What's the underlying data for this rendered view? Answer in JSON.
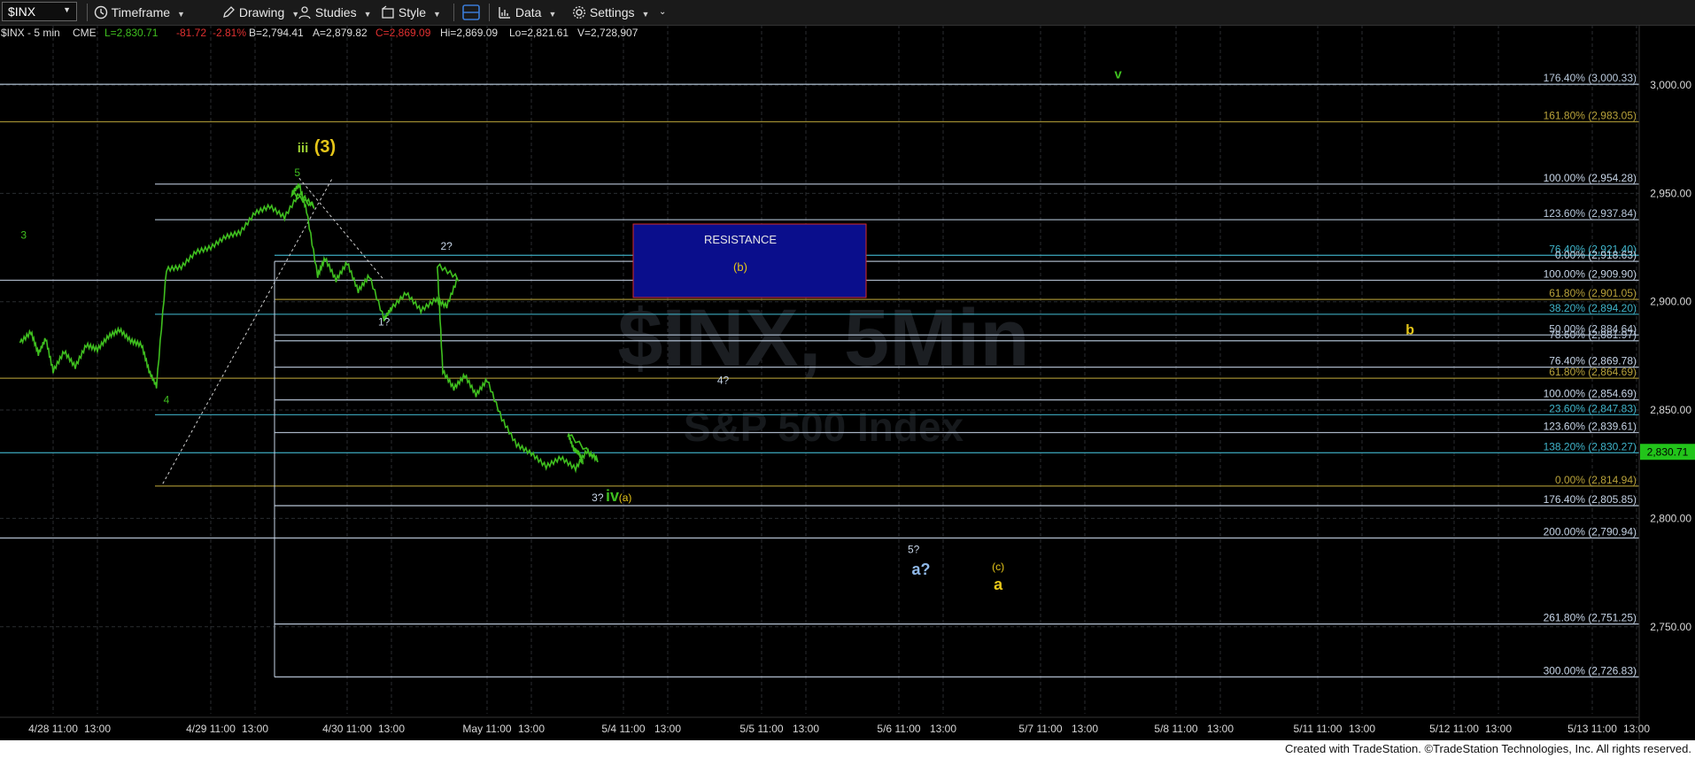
{
  "toolbar": {
    "symbol": "$INX",
    "timeframe": "Timeframe",
    "drawing": "Drawing",
    "studies": "Studies",
    "style": "Style",
    "data": "Data",
    "settings": "Settings"
  },
  "header": {
    "symbol": "$INX - 5 min",
    "exchange": "CME",
    "last": "L=2,830.71",
    "change": "-81.72",
    "pct": "-2.81%",
    "bid": "B=2,794.41",
    "ask": "A=2,879.82",
    "close": "C=2,869.09",
    "hi": "Hi=2,869.09",
    "lo": "Lo=2,821.61",
    "vol": "V=2,728,907"
  },
  "watermark": {
    "title": "$INX, 5Min",
    "subtitle": "S&P 500 Index"
  },
  "price_axis": {
    "ticks": [
      "3,000.00",
      "2,950.00",
      "2,900.00",
      "2,850.00",
      "2,800.00",
      "2,750.00"
    ],
    "tick_values": [
      3000,
      2950,
      2900,
      2850,
      2800,
      2750
    ],
    "last_price": "2,830.71",
    "last_value": 2830.71
  },
  "time_axis": {
    "labels": [
      "4/28 11:00",
      "13:00",
      "4/29 11:00",
      "13:00",
      "4/30 11:00",
      "13:00",
      "May 11:00",
      "13:00",
      "5/4 11:00",
      "13:00",
      "5/5 11:00",
      "13:00",
      "5/6 11:00",
      "13:00",
      "5/7 11:00",
      "13:00",
      "5/8 11:00",
      "13:00",
      "5/11 11:00",
      "13:00",
      "5/12 11:00",
      "13:00",
      "5/13 11:00",
      "13:00"
    ]
  },
  "fib_levels": [
    {
      "label": "176.40% (3,000.33)",
      "price": 3000.33,
      "color": "#b9c9dc"
    },
    {
      "label": "161.80% (2,983.05)",
      "price": 2983.05,
      "color": "#b8a23a"
    },
    {
      "label": "100.00% (2,954.28)",
      "price": 2954.28,
      "color": "#c6d4e6"
    },
    {
      "label": "123.60% (2,937.84)",
      "price": 2937.84,
      "color": "#b9c9dc"
    },
    {
      "label": "76.40% (2,921.40)",
      "price": 2921.4,
      "color": "#3fb3c9"
    },
    {
      "label": "0.00% (2,918.63)",
      "price": 2918.63,
      "color": "#c6d4e6"
    },
    {
      "label": "100.00% (2,909.90)",
      "price": 2909.9,
      "color": "#c6d4e6"
    },
    {
      "label": "61.80% (2,901.05)",
      "price": 2901.05,
      "color": "#b8a23a"
    },
    {
      "label": "38.20% (2,894.20)",
      "price": 2894.2,
      "color": "#3fb3c9"
    },
    {
      "label": "50.00% (2,884.64)",
      "price": 2884.64,
      "color": "#b9c9dc"
    },
    {
      "label": "78.60% (2,881.97)",
      "price": 2881.97,
      "color": "#b9c9dc"
    },
    {
      "label": "76.40% (2,869.78)",
      "price": 2869.78,
      "color": "#c6d4e6"
    },
    {
      "label": "61.80% (2,864.69)",
      "price": 2864.69,
      "color": "#b8a23a"
    },
    {
      "label": "100.00% (2,854.69)",
      "price": 2854.69,
      "color": "#c6d4e6"
    },
    {
      "label": "23.60% (2,847.83)",
      "price": 2847.83,
      "color": "#3fb3c9"
    },
    {
      "label": "123.60% (2,839.61)",
      "price": 2839.61,
      "color": "#c6d4e6"
    },
    {
      "label": "138.20% (2,830.27)",
      "price": 2830.27,
      "color": "#3fb3c9"
    },
    {
      "label": "0.00% (2,814.94)",
      "price": 2814.94,
      "color": "#b8a23a"
    },
    {
      "label": "176.40% (2,805.85)",
      "price": 2805.85,
      "color": "#c6d4e6"
    },
    {
      "label": "200.00% (2,790.94)",
      "price": 2790.94,
      "color": "#c6d4e6"
    },
    {
      "label": "261.80% (2,751.25)",
      "price": 2751.25,
      "color": "#c6d4e6"
    },
    {
      "label": "300.00% (2,726.83)",
      "price": 2726.83,
      "color": "#c6d4e6"
    }
  ],
  "resistance_box": {
    "label": "RESISTANCE",
    "sublabel": "(b)"
  },
  "wave_labels": [
    {
      "text": "v",
      "color": "#3fbf1f",
      "size": 15,
      "bold": true,
      "date": "5/7 14:30",
      "price": 3003
    },
    {
      "text": "iii",
      "color": "#9acd32",
      "size": 15,
      "bold": true,
      "date": "4/30 09:00",
      "price": 2969
    },
    {
      "text": "(3)",
      "color": "#e6c619",
      "size": 20,
      "bold": true,
      "date": "4/30 10:00",
      "price": 2969
    },
    {
      "text": "5",
      "color": "#3fbf1f",
      "size": 12,
      "bold": false,
      "date": "4/30 08:45",
      "price": 2958
    },
    {
      "text": "3",
      "color": "#3fbf1f",
      "size": 12,
      "bold": false,
      "date": "4/28 09:40",
      "price": 2929
    },
    {
      "text": "2?",
      "color": "#c6d4e6",
      "size": 12,
      "bold": false,
      "date": "May 09:10",
      "price": 2924
    },
    {
      "text": "1?",
      "color": "#c6d4e6",
      "size": 12,
      "bold": false,
      "date": "4/30 12:40",
      "price": 2889
    },
    {
      "text": "4",
      "color": "#3fbf1f",
      "size": 12,
      "bold": false,
      "date": "4/29 09:00",
      "price": 2853
    },
    {
      "text": "4?",
      "color": "#c6d4e6",
      "size": 12,
      "bold": false,
      "date": "5/4 15:30",
      "price": 2862
    },
    {
      "text": "b",
      "color": "#e6c619",
      "size": 16,
      "bold": true,
      "date": "5/11 15:10",
      "price": 2885
    },
    {
      "text": "3?",
      "color": "#c6d4e6",
      "size": 12,
      "bold": false,
      "date": "5/4 09:50",
      "price": 2808
    },
    {
      "text": "iv",
      "color": "#3fbf1f",
      "size": 18,
      "bold": true,
      "date": "5/4 10:30",
      "price": 2808
    },
    {
      "text": "(a)",
      "color": "#e6c619",
      "size": 12,
      "bold": false,
      "date": "5/4 11:05",
      "price": 2808
    },
    {
      "text": "5?",
      "color": "#c6d4e6",
      "size": 12,
      "bold": false,
      "date": "5/6 11:40",
      "price": 2784
    },
    {
      "text": "a?",
      "color": "#8fb8e8",
      "size": 18,
      "bold": true,
      "date": "5/6 12:00",
      "price": 2774
    },
    {
      "text": "(c)",
      "color": "#e6c619",
      "size": 12,
      "bold": false,
      "date": "5/7 09:05",
      "price": 2776
    },
    {
      "text": "a",
      "color": "#e6c619",
      "size": 18,
      "bold": true,
      "date": "5/7 09:05",
      "price": 2767
    }
  ],
  "footer": "Created with TradeStation. ©TradeStation Technologies, Inc. All rights reserved.",
  "colors": {
    "price_line": "#3fbf1f",
    "last_badge": "#22c41a",
    "resistance_fill": "#0a0e8c",
    "resistance_border": "#d62a2a"
  }
}
